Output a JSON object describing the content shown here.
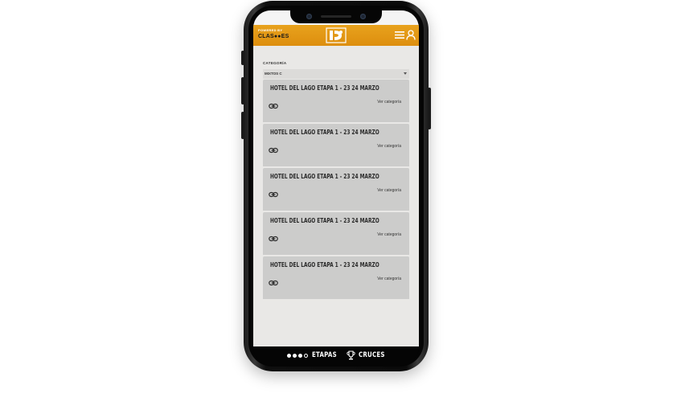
{
  "header": {
    "powered_by": "POWERED BY",
    "brand": "CLAS●●ES"
  },
  "filter": {
    "label": "CATEGORÍA",
    "selected": "MIXTOS C"
  },
  "cards": [
    {
      "title": "HOTEL DEL LAGO ETAPA 1 - 23 24 MARZO",
      "link": "Ver categoría"
    },
    {
      "title": "HOTEL DEL LAGO ETAPA 1 - 23 24 MARZO",
      "link": "Ver categoría"
    },
    {
      "title": "HOTEL DEL LAGO ETAPA 1 - 23 24 MARZO",
      "link": "Ver categoría"
    },
    {
      "title": "HOTEL DEL LAGO ETAPA 1 - 23 24 MARZO",
      "link": "Ver categoría"
    },
    {
      "title": "HOTEL DEL LAGO ETAPA 1 - 23 24 MARZO",
      "link": "Ver categoría"
    }
  ],
  "bottom_nav": {
    "etapas": "ETAPAS",
    "cruces": "CRUCES"
  },
  "colors": {
    "header_orange": "#e39a17",
    "card_gray": "#cccccb",
    "screen_bg": "#e9e8e6"
  },
  "icons": {
    "menu": "hamburger-icon",
    "user": "user-icon",
    "card": "chain-link-icon",
    "cruces": "trophy-icon"
  }
}
